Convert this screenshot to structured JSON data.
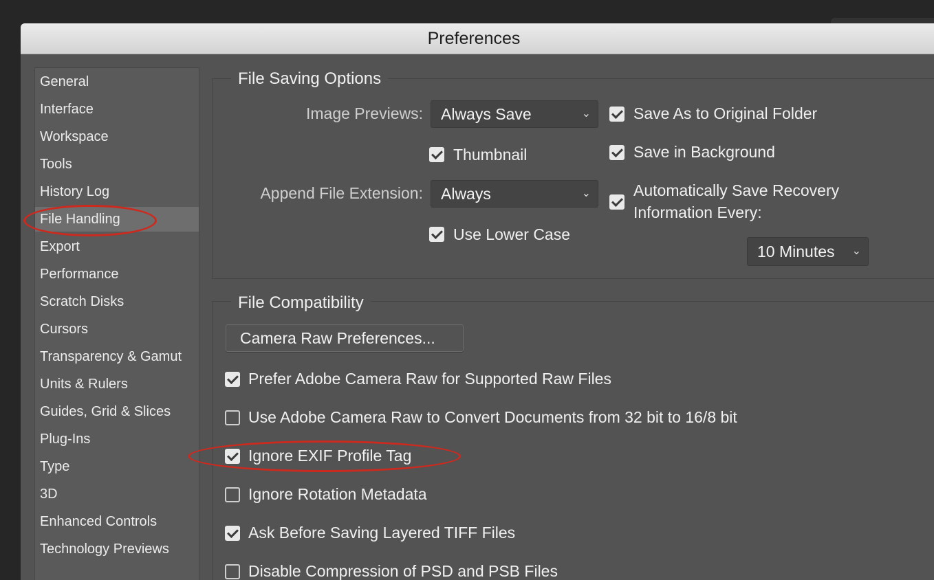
{
  "window": {
    "title": "Preferences"
  },
  "sidebar": {
    "items": [
      {
        "label": "General"
      },
      {
        "label": "Interface"
      },
      {
        "label": "Workspace"
      },
      {
        "label": "Tools"
      },
      {
        "label": "History Log"
      },
      {
        "label": "File Handling",
        "selected": true
      },
      {
        "label": "Export"
      },
      {
        "label": "Performance"
      },
      {
        "label": "Scratch Disks"
      },
      {
        "label": "Cursors"
      },
      {
        "label": "Transparency & Gamut"
      },
      {
        "label": "Units & Rulers"
      },
      {
        "label": "Guides, Grid & Slices"
      },
      {
        "label": "Plug-Ins"
      },
      {
        "label": "Type"
      },
      {
        "label": "3D"
      },
      {
        "label": "Enhanced Controls"
      },
      {
        "label": "Technology Previews"
      }
    ]
  },
  "file_saving": {
    "title": "File Saving Options",
    "image_previews": {
      "label": "Image Previews:",
      "value": "Always Save"
    },
    "thumbnail": {
      "label": "Thumbnail",
      "checked": true
    },
    "append_extension": {
      "label": "Append File Extension:",
      "value": "Always"
    },
    "lower_case": {
      "label": "Use Lower Case",
      "checked": true
    },
    "save_as_original": {
      "label": "Save As to Original Folder",
      "checked": true
    },
    "save_background": {
      "label": "Save in Background",
      "checked": true
    },
    "auto_recovery": {
      "label_line1": "Automatically Save Recovery",
      "label_line2": "Information Every:",
      "checked": true
    },
    "recovery_interval": {
      "value": "10 Minutes"
    }
  },
  "file_compat": {
    "title": "File Compatibility",
    "camera_raw_button": "Camera Raw Preferences...",
    "options": [
      {
        "label": "Prefer Adobe Camera Raw for Supported Raw Files",
        "checked": true
      },
      {
        "label": "Use Adobe Camera Raw to Convert Documents from 32 bit to 16/8 bit",
        "checked": false
      },
      {
        "label": "Ignore EXIF Profile Tag",
        "checked": true
      },
      {
        "label": "Ignore Rotation Metadata",
        "checked": false
      },
      {
        "label": "Ask Before Saving Layered TIFF Files",
        "checked": true
      },
      {
        "label": "Disable Compression of PSD and PSB Files",
        "checked": false
      }
    ]
  },
  "colors": {
    "annotation": "#cc2a1f",
    "dialog_bg": "#535353",
    "titlebar": "#dcdcdc"
  }
}
